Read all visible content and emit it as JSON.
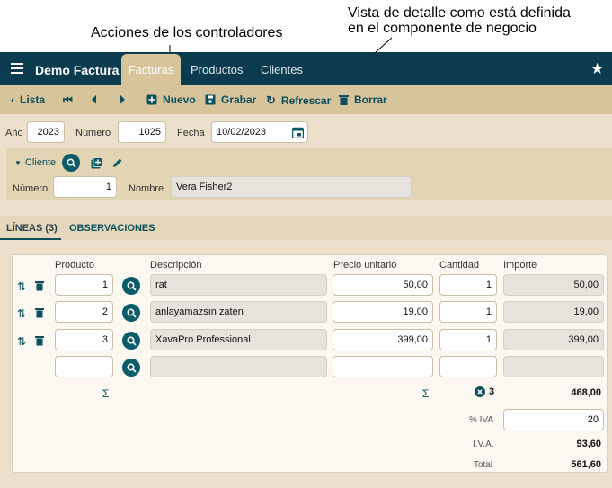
{
  "annotations": {
    "actions": "Acciones de los controladores",
    "detail_line1": "Vista de detalle como está definida",
    "detail_line2": "en el componente de negocio"
  },
  "app": {
    "title": "Demo Factura :",
    "tabs": [
      "Facturas",
      "Productos",
      "Clientes"
    ]
  },
  "toolbar": {
    "list": "Lista",
    "new": "Nuevo",
    "save": "Grabar",
    "refresh": "Refrescar",
    "delete": "Borrar"
  },
  "form": {
    "year_label": "Año",
    "year": "2023",
    "number_label": "Número",
    "number": "1025",
    "date_label": "Fecha",
    "date": "10/02/2023"
  },
  "cliente": {
    "title": "Cliente",
    "number_label": "Número",
    "number": "1",
    "name_label": "Nombre",
    "name": "Vera Fisher2"
  },
  "detail_tabs": [
    "LÍNEAS (3)",
    "OBSERVACIONES"
  ],
  "lines": {
    "columns": [
      "Producto",
      "Descripción",
      "Precio unitario",
      "Cantidad",
      "Importe"
    ],
    "rows": [
      {
        "product": "1",
        "description": "rat",
        "price": "50,00",
        "qty": "1",
        "amount": "50,00"
      },
      {
        "product": "2",
        "description": "anlayamazsın zaten",
        "price": "19,00",
        "qty": "1",
        "amount": "19,00"
      },
      {
        "product": "3",
        "description": "XavaPro Professional",
        "price": "399,00",
        "qty": "1",
        "amount": "399,00"
      }
    ],
    "sigma": "Σ",
    "qty_total": "3",
    "amount_total": "468,00"
  },
  "totals": {
    "vat_pct_label": "% IVA",
    "vat_pct": "20",
    "vat_label": "I.V.A.",
    "vat": "93,60",
    "total_label": "Total",
    "total": "561,60"
  },
  "colors": {
    "topbar": "#0b3b4f",
    "toolbar": "#d8c49a",
    "accent": "#0b5b68",
    "panel": "#ebdfc9"
  }
}
